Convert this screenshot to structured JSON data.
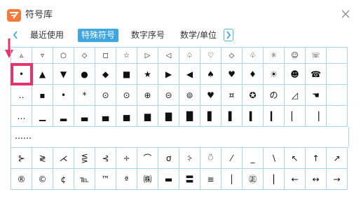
{
  "window": {
    "title": "符号库"
  },
  "tabs": [
    {
      "label": "最近使用"
    },
    {
      "label": "特殊符号"
    },
    {
      "label": "数字序号"
    },
    {
      "label": "数学/单位"
    }
  ],
  "rows": [
    [
      "▵",
      "▿",
      "○",
      "◇",
      "◻",
      "☆",
      "▷",
      "◁",
      "♤",
      "♡",
      "◇",
      "♧",
      "☼",
      "☺",
      "☏"
    ],
    [
      "•",
      "▲",
      "▼",
      "●",
      "◆",
      "■",
      "★",
      "▶",
      "◀",
      "♠",
      "♥",
      "♦",
      "☀",
      "☻",
      "☎"
    ],
    [
      "‥",
      "▪",
      "•",
      "*",
      "⊙",
      "⊙",
      "⊕",
      "⊝",
      "⊚",
      "♥",
      "¤",
      "✪",
      "の",
      "◿",
      "☚"
    ],
    [
      "…",
      "▁",
      "▂",
      "▃",
      "▄",
      "▅",
      "▆",
      "▇",
      "█",
      "▋",
      "▌",
      "▍",
      "▎",
      "▏",
      "▕"
    ],
    [
      "……"
    ],
    [
      "⊱",
      "≷",
      "⋌",
      "⋚",
      "⊰",
      "÷",
      "⌒",
      "ơ",
      "⸖",
      "⍥",
      "⁄",
      "_",
      "∖",
      "↖",
      "↑",
      "↗"
    ],
    [
      "®",
      "©",
      "¢",
      "℡",
      "™",
      "ª",
      "㈱",
      "▬",
      "〓",
      "≡",
      "│",
      "㊣",
      "⎮",
      "←",
      "↔",
      "→"
    ]
  ],
  "icons": {
    "logo": "symbol-library-logo",
    "close": "close-icon",
    "prev": "chevron-left-icon",
    "next": "chevron-right-icon",
    "pointer": "pink-arrow-icon"
  },
  "colors": {
    "accent": "#3ea7e1",
    "grid_border": "#a8d6ee",
    "highlight": "#e8336a",
    "logo": "#f47b3a"
  }
}
